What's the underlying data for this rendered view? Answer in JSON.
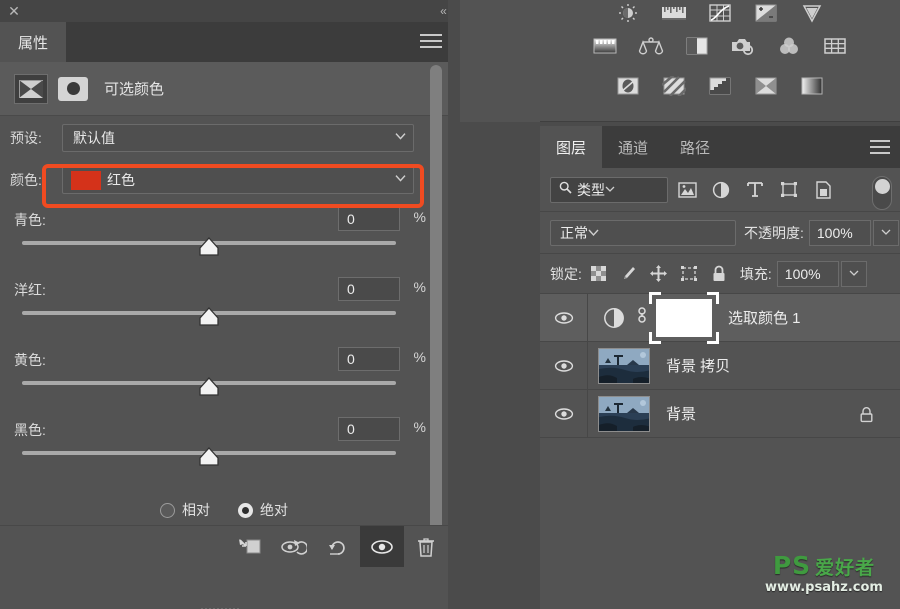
{
  "properties_panel": {
    "close_label": "✕",
    "collapse_label": "«",
    "tab_label": "属性",
    "menu_name": "panel-menu-icon",
    "adjustment_type_label": "可选颜色",
    "preset": {
      "label": "预设:",
      "value": "默认值"
    },
    "color": {
      "label": "颜色:",
      "value": "红色",
      "swatch_hex": "#d4321a",
      "highlight_hex": "#f04b21"
    },
    "sliders": [
      {
        "name": "青色:",
        "value": "0",
        "unit": "%",
        "thumb_pct": 50
      },
      {
        "name": "洋红:",
        "value": "0",
        "unit": "%",
        "thumb_pct": 50
      },
      {
        "name": "黄色:",
        "value": "0",
        "unit": "%",
        "thumb_pct": 50
      },
      {
        "name": "黑色:",
        "value": "0",
        "unit": "%",
        "thumb_pct": 50
      }
    ],
    "method": {
      "relative_label": "相对",
      "absolute_label": "绝对",
      "selected": "绝对"
    },
    "footer_buttons": [
      {
        "name": "clip-to-layer-button",
        "active": false
      },
      {
        "name": "preview-previous-state-button",
        "active": false
      },
      {
        "name": "reset-button",
        "active": false
      },
      {
        "name": "toggle-visibility-button",
        "active": true
      },
      {
        "name": "delete-button",
        "active": false
      }
    ]
  },
  "adjustments_panel": {
    "row1": [
      "brightness-contrast-icon",
      "levels-icon",
      "curves-icon",
      "exposure-icon",
      "vibrance-icon"
    ],
    "row2": [
      "hue-saturation-icon",
      "color-balance-icon",
      "black-white-icon",
      "photo-filter-icon",
      "channel-mixer-icon",
      "color-lookup-icon"
    ],
    "row3": [
      "invert-icon",
      "posterize-icon",
      "threshold-icon",
      "selective-color-icon",
      "gradient-map-icon"
    ]
  },
  "layers_panel": {
    "tabs": [
      {
        "label": "图层",
        "active": true
      },
      {
        "label": "通道",
        "active": false
      },
      {
        "label": "路径",
        "active": false
      }
    ],
    "menu_name": "layers-panel-menu-icon",
    "filter": {
      "type_label": "类型",
      "icons": [
        "pixel-filter-icon",
        "adjustment-filter-icon",
        "type-filter-icon",
        "shape-filter-icon",
        "smart-object-filter-icon"
      ],
      "toggle_on": true
    },
    "blend": {
      "mode": "正常",
      "opacity_label": "不透明度:",
      "opacity_value": "100%"
    },
    "lock": {
      "label": "锁定:",
      "icons": [
        "lock-transparent-pixels-icon",
        "lock-image-pixels-icon",
        "lock-position-icon",
        "lock-artboard-nesting-icon",
        "lock-all-icon"
      ],
      "fill_label": "填充:",
      "fill_value": "100%"
    },
    "layers": [
      {
        "name": "选取颜色 1",
        "kind": "adjustment",
        "visible": true,
        "selected": true,
        "linked": true,
        "locked": false
      },
      {
        "name": "背景 拷贝",
        "kind": "image",
        "visible": true,
        "selected": false,
        "linked": false,
        "locked": false
      },
      {
        "name": "背景",
        "kind": "image",
        "visible": true,
        "selected": false,
        "linked": false,
        "locked": true
      }
    ]
  },
  "watermark": {
    "brand": "PS",
    "brand_cn": "爱好者",
    "url": "www.psahz.com",
    "color_hex": "#3f9a3f"
  }
}
